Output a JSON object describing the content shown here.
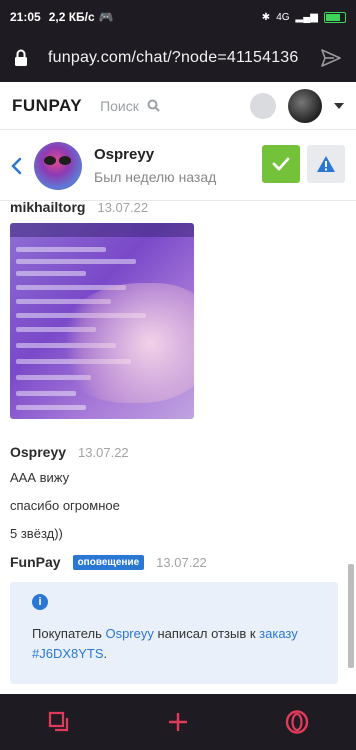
{
  "status_bar": {
    "time": "21:05",
    "speed": "2,2 КБ/с",
    "network": "4G"
  },
  "browser": {
    "url": "funpay.com/chat/?node=41154136"
  },
  "header": {
    "logo": "FUNPAY",
    "search_placeholder": "Поиск"
  },
  "chat": {
    "peer_name": "Ospreyy",
    "peer_status": "Был неделю назад"
  },
  "messages": [
    {
      "author": "mikhailtorg",
      "date": "13.07.22",
      "type": "image"
    },
    {
      "author": "Ospreyy",
      "date": "13.07.22",
      "lines": [
        "ААА вижу",
        "спасибо огромное",
        "5 звёзд))"
      ]
    },
    {
      "author": "FunPay",
      "badge": "оповещение",
      "date": "13.07.22",
      "notice": {
        "prefix": "Покупатель ",
        "buyer": "Ospreyy",
        "middle": " написал отзыв к ",
        "order_word": "заказу",
        "order_id": "#J6DX8YTS",
        "suffix": "."
      }
    }
  ],
  "colors": {
    "accent": "#2a78d4",
    "confirm": "#74c13a",
    "nav_icon": "#e23a5a",
    "dark_bar": "#1e1c22"
  },
  "icons": [
    "lock-icon",
    "send-icon",
    "search-icon",
    "back-icon",
    "check-icon",
    "warning-icon",
    "info-icon",
    "tabs-icon",
    "plus-icon",
    "opera-icon"
  ]
}
